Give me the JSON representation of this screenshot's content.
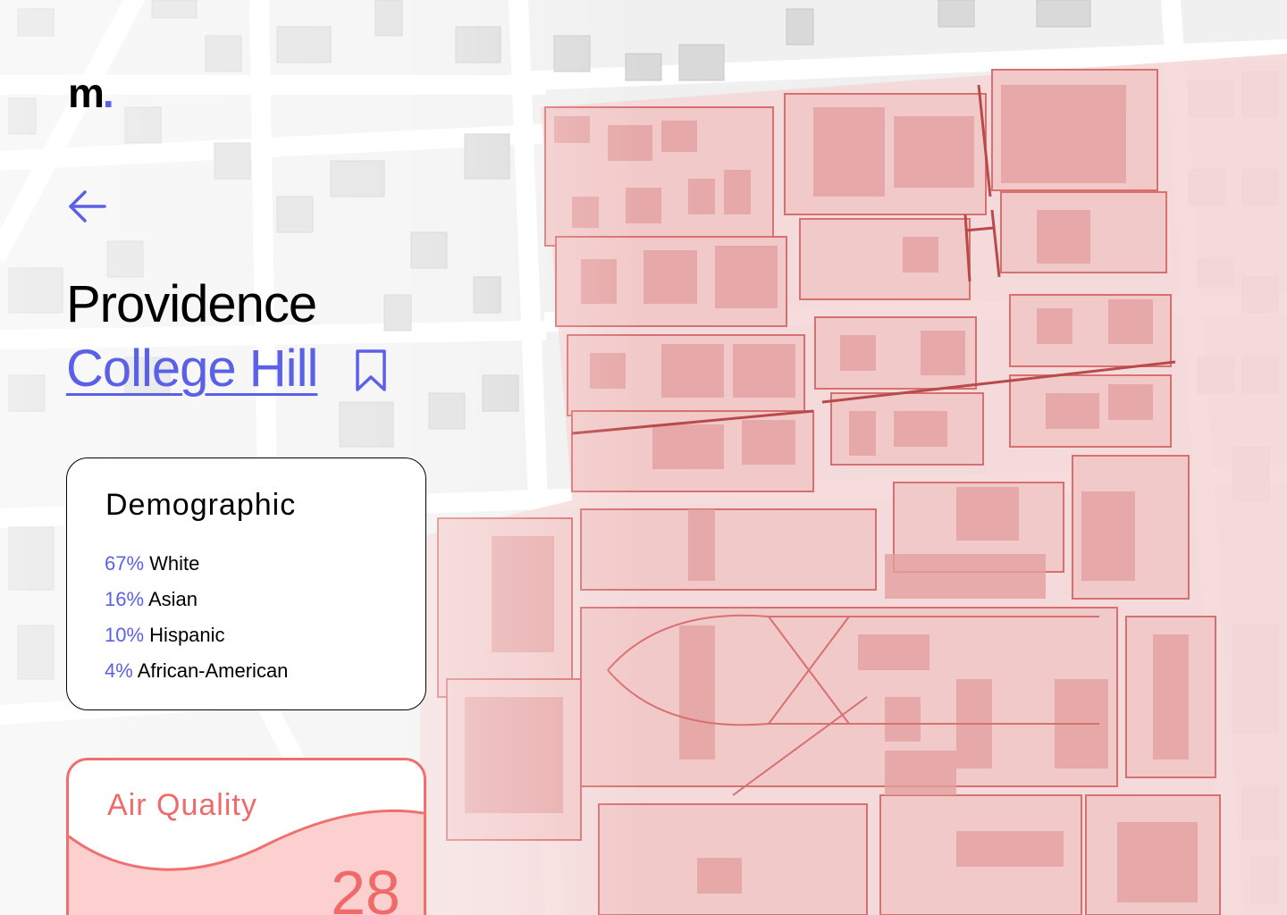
{
  "brand": {
    "logo_text": "m",
    "logo_dot": "."
  },
  "nav": {
    "back_icon": "arrow-left-icon"
  },
  "location": {
    "city": "Providence",
    "neighborhood": "College Hill",
    "bookmark_icon": "bookmark-icon"
  },
  "demographic": {
    "title": "Demographic",
    "items": [
      {
        "pct": "67%",
        "label": "White"
      },
      {
        "pct": "16%",
        "label": "Asian"
      },
      {
        "pct": "10%",
        "label": "Hispanic"
      },
      {
        "pct": "4%",
        "label": "African-American"
      }
    ]
  },
  "air_quality": {
    "title": "Air Quality",
    "value": "28"
  },
  "colors": {
    "accent": "#5b61e6",
    "highlight_red": "#e87878",
    "air_red": "#f06a6a"
  }
}
